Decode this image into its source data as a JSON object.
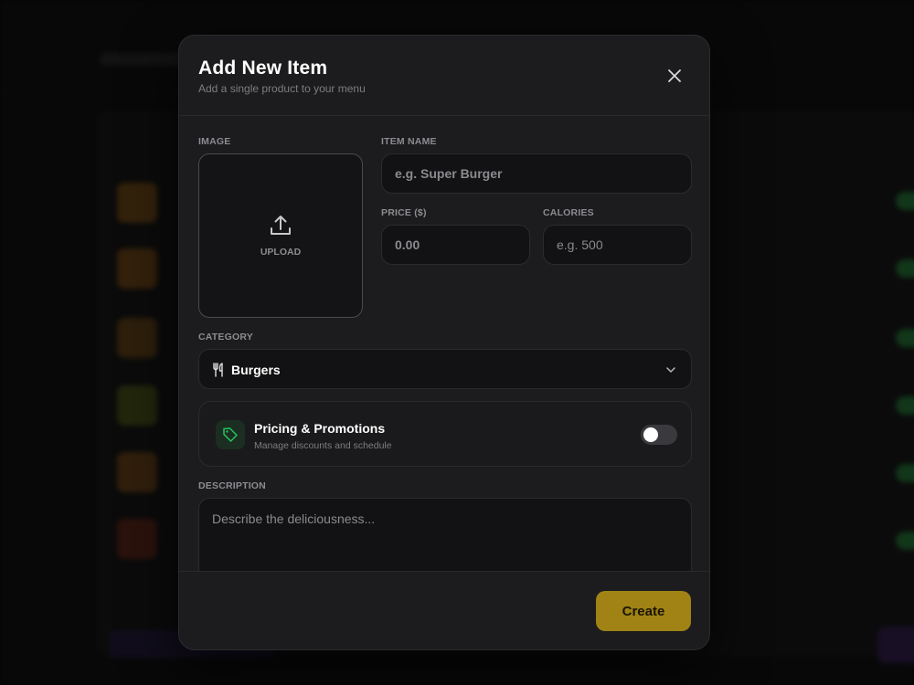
{
  "modal": {
    "title": "Add New Item",
    "subtitle": "Add a single product to your menu",
    "close_icon": "close-icon"
  },
  "image": {
    "label": "IMAGE",
    "upload_label": "UPLOAD",
    "icon": "upload-icon"
  },
  "item_name": {
    "label": "ITEM NAME",
    "value": "",
    "placeholder": "e.g. Super Burger"
  },
  "price": {
    "label": "PRICE ($)",
    "value": "",
    "placeholder": "0.00"
  },
  "calories": {
    "label": "CALORIES",
    "value": "",
    "placeholder": "e.g. 500"
  },
  "category": {
    "label": "CATEGORY",
    "selected": "Burgers",
    "icon": "utensils-icon"
  },
  "promotions": {
    "title": "Pricing & Promotions",
    "subtitle": "Manage discounts and schedule",
    "icon": "tag-icon",
    "enabled": false,
    "accent": "#22c55e"
  },
  "description": {
    "label": "DESCRIPTION",
    "value": "",
    "placeholder": "Describe the deliciousness..."
  },
  "footer": {
    "create_label": "Create",
    "accent": "#a08314"
  }
}
